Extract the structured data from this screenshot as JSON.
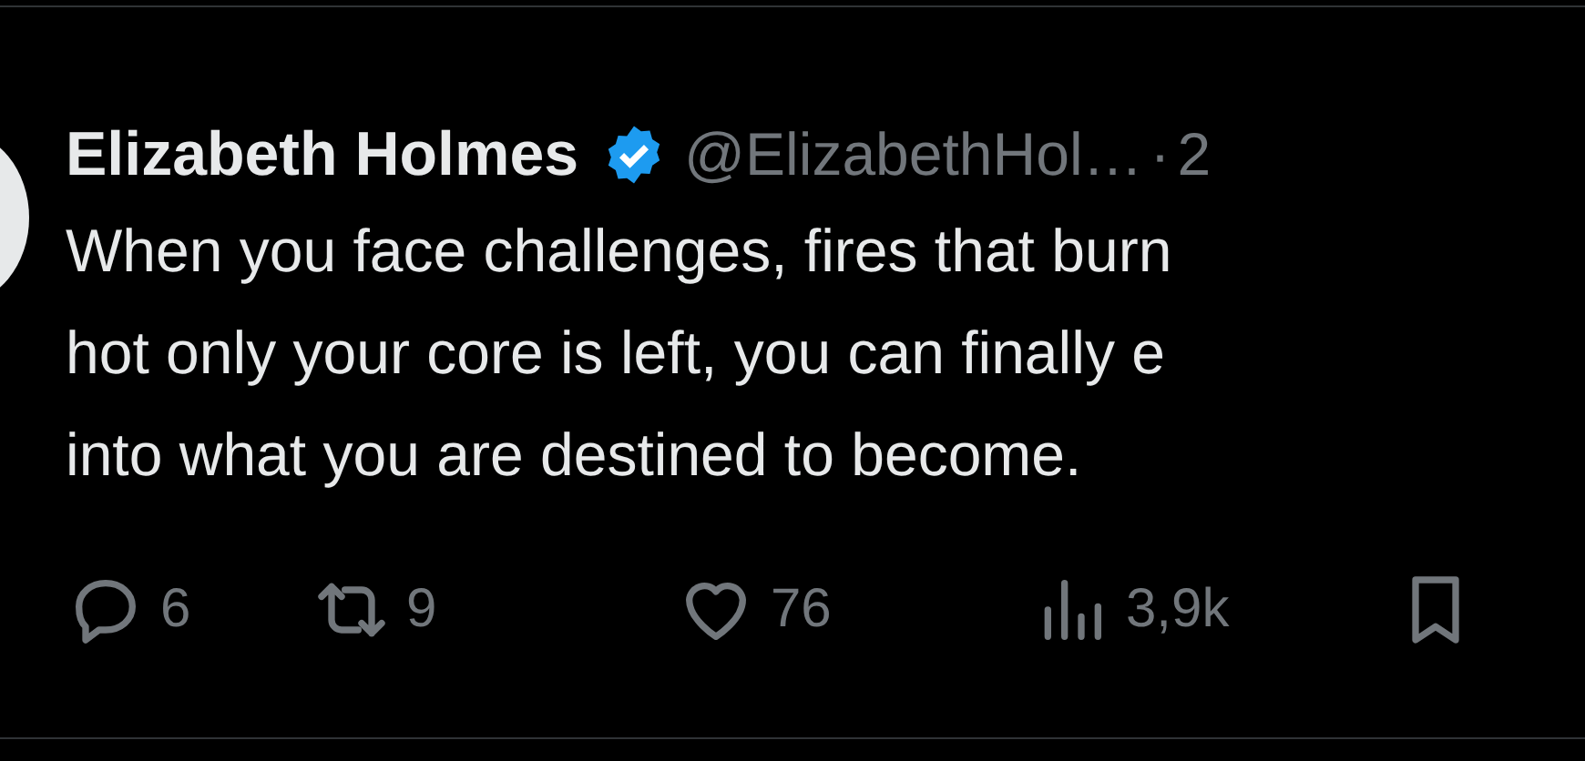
{
  "tweet": {
    "name": "Elizabeth Holmes",
    "verified": true,
    "handle": "@ElizabethHol…",
    "separator": "·",
    "time": "2",
    "lines": [
      "When you face challenges, fires that burn",
      "hot only your core is left, you can finally e",
      "into what you are destined to become."
    ],
    "actions": [
      {
        "kind": "reply",
        "count": "6"
      },
      {
        "kind": "retweet",
        "count": "9"
      },
      {
        "kind": "like",
        "count": "76"
      },
      {
        "kind": "views",
        "count": "3,9k"
      },
      {
        "kind": "bookmark"
      }
    ]
  }
}
